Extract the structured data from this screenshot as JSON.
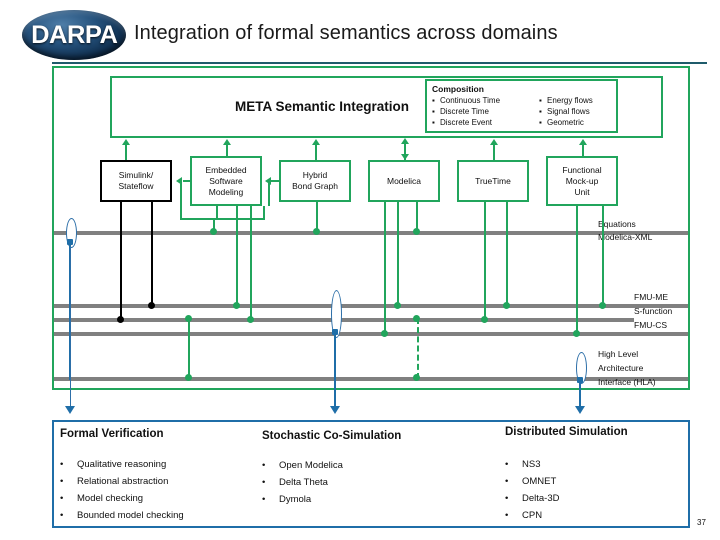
{
  "header": {
    "logo_text": "DARPA",
    "title": "Integration of formal semantics across domains"
  },
  "diagram": {
    "meta_layer_label": "META Semantic Integration",
    "composition": {
      "title": "Composition",
      "left_items": [
        "Continuous Time",
        "Discrete Time",
        "Discrete Event"
      ],
      "right_items": [
        "Energy flows",
        "Signal flows",
        "Geometric"
      ]
    },
    "tools": [
      {
        "label": "Simulink/\nStateflow",
        "border": "#000000"
      },
      {
        "label": "Embedded\nSoftware\nModeling",
        "border": "#21a55c"
      },
      {
        "label": "Hybrid\nBond Graph",
        "border": "#21a55c"
      },
      {
        "label": "Modelica",
        "border": "#21a55c"
      },
      {
        "label": "TrueTime",
        "border": "#21a55c"
      },
      {
        "label": "Functional\nMock-up\nUnit",
        "border": "#21a55c"
      }
    ],
    "bus_labels": {
      "equations": "Equations",
      "modelica_xml": "Modelica-XML",
      "fmu_me": "FMU-ME",
      "s_function": "S-function",
      "fmu_cs": "FMU-CS",
      "hla_1": "High Level",
      "hla_2": "Architecture",
      "hla_3": "Interface (HLA)"
    }
  },
  "bottom": {
    "columns": [
      {
        "heading": "Formal Verification",
        "items": [
          "Qualitative reasoning",
          "Relational abstraction",
          "Model checking",
          "Bounded model checking"
        ]
      },
      {
        "heading": "Stochastic Co-Simulation",
        "items": [
          "Open Modelica",
          "Delta Theta",
          "Dymola"
        ]
      },
      {
        "heading": "Distributed Simulation",
        "items": [
          "NS3",
          "OMNET",
          "Delta-3D",
          "CPN"
        ]
      }
    ]
  },
  "footer": {
    "page_number": "37"
  },
  "colors": {
    "green": "#21a55c",
    "blue": "#1f6ea8",
    "gray_bus": "#808080",
    "rule": "#1f5b6b"
  }
}
